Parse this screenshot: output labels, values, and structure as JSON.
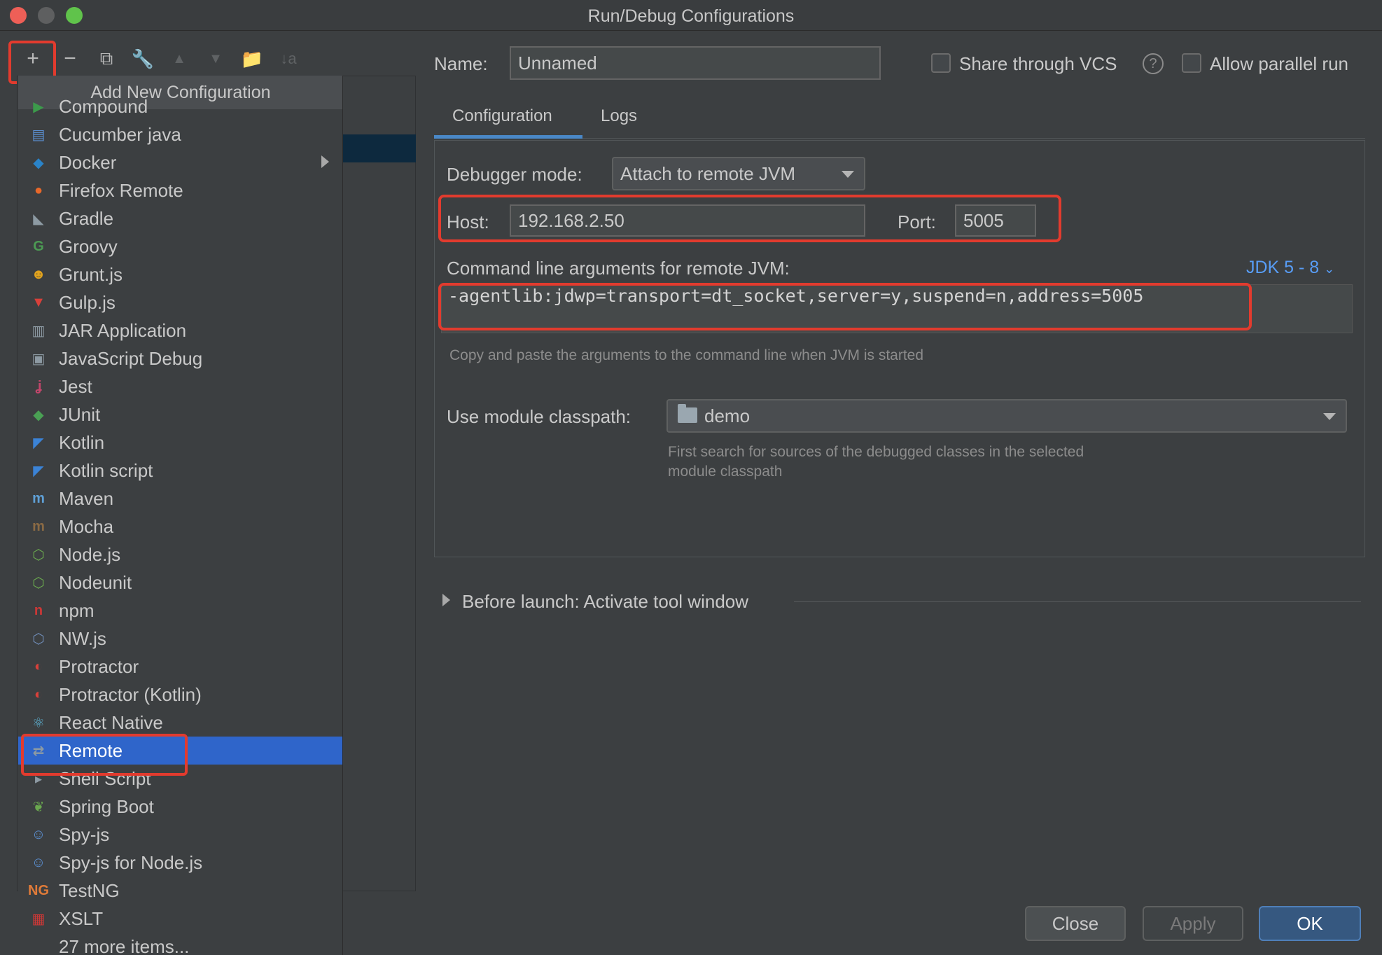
{
  "window": {
    "title": "Run/Debug Configurations"
  },
  "toolbar": {
    "add": "+",
    "remove": "−",
    "copy": "⧉",
    "edit": "🔧",
    "up": "▲",
    "down": "▼",
    "folder": "📁",
    "sort": "↓a"
  },
  "popup": {
    "header": "Add New Configuration",
    "items": [
      {
        "label": "Compound",
        "icon": "compound-icon",
        "glyph": "▶",
        "color": "#3c9a4b"
      },
      {
        "label": "Cucumber java",
        "icon": "cucumber-icon",
        "glyph": "▤",
        "color": "#5b8fd0"
      },
      {
        "label": "Docker",
        "icon": "docker-icon",
        "glyph": "◆",
        "color": "#2a83c8",
        "submenu": true
      },
      {
        "label": "Firefox Remote",
        "icon": "firefox-icon",
        "glyph": "●",
        "color": "#e7682a"
      },
      {
        "label": "Gradle",
        "icon": "gradle-icon",
        "glyph": "◣",
        "color": "#8d9aa3"
      },
      {
        "label": "Groovy",
        "icon": "groovy-icon",
        "glyph": "G",
        "color": "#4c9a53"
      },
      {
        "label": "Grunt.js",
        "icon": "grunt-icon",
        "glyph": "☻",
        "color": "#e0a21e"
      },
      {
        "label": "Gulp.js",
        "icon": "gulp-icon",
        "glyph": "▼",
        "color": "#d9403a"
      },
      {
        "label": "JAR Application",
        "icon": "jar-icon",
        "glyph": "▥",
        "color": "#8d9aa3"
      },
      {
        "label": "JavaScript Debug",
        "icon": "js-debug-icon",
        "glyph": "▣",
        "color": "#8d9aa3"
      },
      {
        "label": "Jest",
        "icon": "jest-icon",
        "glyph": "ʝ",
        "color": "#c2466b"
      },
      {
        "label": "JUnit",
        "icon": "junit-icon",
        "glyph": "◆",
        "color": "#4aa054"
      },
      {
        "label": "Kotlin",
        "icon": "kotlin-icon",
        "glyph": "◤",
        "color": "#3b83d6"
      },
      {
        "label": "Kotlin script",
        "icon": "kotlin-script-icon",
        "glyph": "◤",
        "color": "#3b83d6"
      },
      {
        "label": "Maven",
        "icon": "maven-icon",
        "glyph": "m",
        "color": "#5fa0d6"
      },
      {
        "label": "Mocha",
        "icon": "mocha-icon",
        "glyph": "m",
        "color": "#8a6a44"
      },
      {
        "label": "Node.js",
        "icon": "nodejs-icon",
        "glyph": "⬡",
        "color": "#6aa84f"
      },
      {
        "label": "Nodeunit",
        "icon": "nodeunit-icon",
        "glyph": "⬡",
        "color": "#6aa84f"
      },
      {
        "label": "npm",
        "icon": "npm-icon",
        "glyph": "n",
        "color": "#cb3837"
      },
      {
        "label": "NW.js",
        "icon": "nwjs-icon",
        "glyph": "⬡",
        "color": "#6f8bb5"
      },
      {
        "label": "Protractor",
        "icon": "protractor-icon",
        "glyph": "◐",
        "color": "#d9403a"
      },
      {
        "label": "Protractor (Kotlin)",
        "icon": "protractor-kotlin-icon",
        "glyph": "◐",
        "color": "#d9403a"
      },
      {
        "label": "React Native",
        "icon": "react-native-icon",
        "glyph": "⚛",
        "color": "#5fb7d9"
      },
      {
        "label": "Remote",
        "icon": "remote-icon",
        "glyph": "⇄",
        "color": "#8d9aa3",
        "selected": true
      },
      {
        "label": "Shell Script",
        "icon": "shell-script-icon",
        "glyph": "▸",
        "color": "#8d9aa3"
      },
      {
        "label": "Spring Boot",
        "icon": "spring-boot-icon",
        "glyph": "❦",
        "color": "#6aa84f"
      },
      {
        "label": "Spy-js",
        "icon": "spy-js-icon",
        "glyph": "☺",
        "color": "#5b8fd0"
      },
      {
        "label": "Spy-js for Node.js",
        "icon": "spy-js-node-icon",
        "glyph": "☺",
        "color": "#5b8fd0"
      },
      {
        "label": "TestNG",
        "icon": "testng-icon",
        "glyph": "NG",
        "color": "#e07b39"
      },
      {
        "label": "XSLT",
        "icon": "xslt-icon",
        "glyph": "▦",
        "color": "#cb3837"
      },
      {
        "label": "27 more items...",
        "icon": "",
        "glyph": "",
        "color": ""
      }
    ]
  },
  "header": {
    "name_label": "Name:",
    "name_value": "Unnamed",
    "share_label": "Share through VCS",
    "parallel_label": "Allow parallel run"
  },
  "tabs": [
    {
      "label": "Configuration",
      "active": true
    },
    {
      "label": "Logs"
    }
  ],
  "config": {
    "debugger_mode_label": "Debugger mode:",
    "debugger_mode_value": "Attach to remote JVM",
    "host_label": "Host:",
    "host_value": "192.168.2.50",
    "port_label": "Port:",
    "port_value": "5005",
    "cmd_label": "Command line arguments for remote JVM:",
    "jdk_link": "JDK 5 - 8",
    "cmd_value": "-agentlib:jdwp=transport=dt_socket,server=y,suspend=n,address=5005",
    "cmd_hint": "Copy and paste the arguments to the command line when JVM is started",
    "classpath_label": "Use module classpath:",
    "classpath_value": "demo",
    "classpath_hint_1": "First search for sources of the debugged classes in the selected",
    "classpath_hint_2": "module classpath"
  },
  "before_launch": {
    "label": "Before launch: Activate tool window"
  },
  "buttons": {
    "close": "Close",
    "apply": "Apply",
    "ok": "OK"
  },
  "colors": {
    "highlight": "#e23b2e",
    "selection": "#2f65ca",
    "link": "#589df6"
  }
}
